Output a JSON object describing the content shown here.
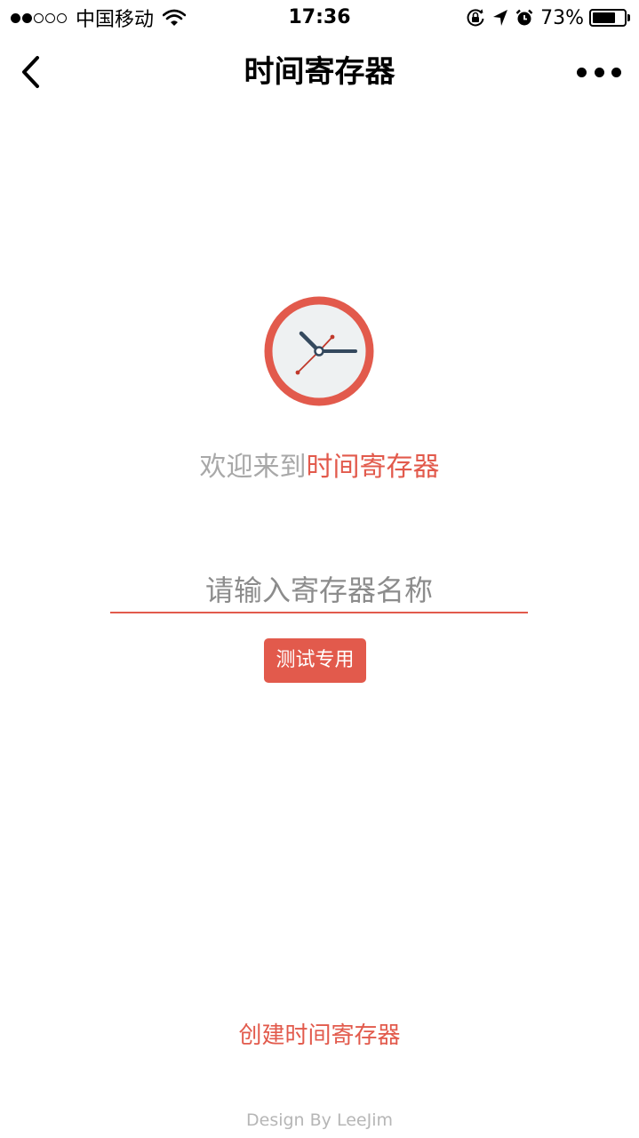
{
  "status_bar": {
    "signal_dots_filled": 2,
    "signal_dots_total": 5,
    "carrier": "中国移动",
    "time": "17:36",
    "battery_percent_text": "73%",
    "battery_level": 0.73,
    "icons": [
      "signal-dots-icon",
      "wifi-icon",
      "rotation-lock-icon",
      "location-arrow-icon",
      "alarm-icon",
      "battery-icon"
    ]
  },
  "nav_bar": {
    "title": "时间寄存器",
    "back_icon": "chevron-left-icon",
    "more_icon": "more-dots-icon"
  },
  "main": {
    "logo_icon": "clock-icon",
    "welcome_prefix": "欢迎来到",
    "welcome_highlight": "时间寄存器",
    "input": {
      "value": "",
      "placeholder": "请输入寄存器名称"
    },
    "test_button_label": "测试专用",
    "create_link_label": "创建时间寄存器",
    "footer_text": "Design By LeeJim"
  },
  "colors": {
    "accent": "#e25a4c",
    "muted_text": "#a8a8a8",
    "clock_face": "#eef1f2",
    "clock_hands": "#34495e"
  }
}
